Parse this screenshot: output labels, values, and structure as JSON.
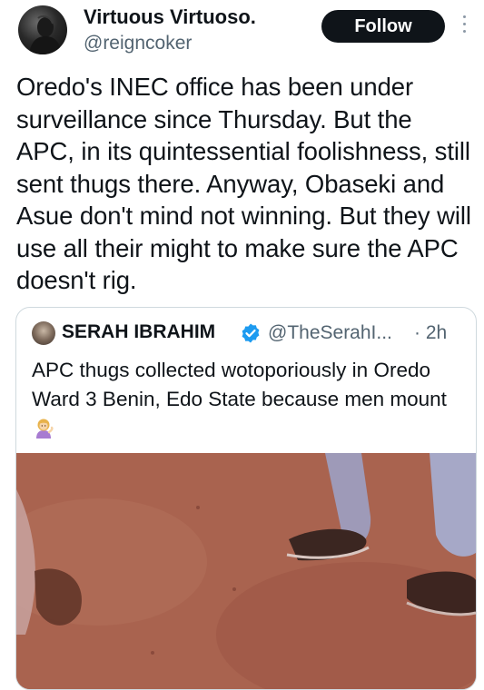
{
  "author": {
    "display_name": "Virtuous Virtuoso.",
    "handle": "@reigncoker",
    "follow_label": "Follow"
  },
  "tweet": {
    "text": "Oredo's INEC office has been under surveillance since Thursday. But the APC, in its quintessential foolishness, still sent thugs there. Anyway, Obaseki and Asue don't mind not winning. But they will use all their might to make sure the APC doesn't rig."
  },
  "quoted_tweet": {
    "display_name": "SERAH IBRAHIM",
    "handle": "@TheSerahI...",
    "time": "· 2h",
    "text": "APC thugs collected wotoporiously in Oredo Ward 3 Benin, Edo State because men mount",
    "emoji_icon": "woman-tipping-hand-emoji",
    "verified_color": "#1d9bf0"
  },
  "colors": {
    "text_primary": "#0f1419",
    "text_secondary": "#536471",
    "follow_button_bg": "#0f1419",
    "card_border": "#cfd9de"
  }
}
